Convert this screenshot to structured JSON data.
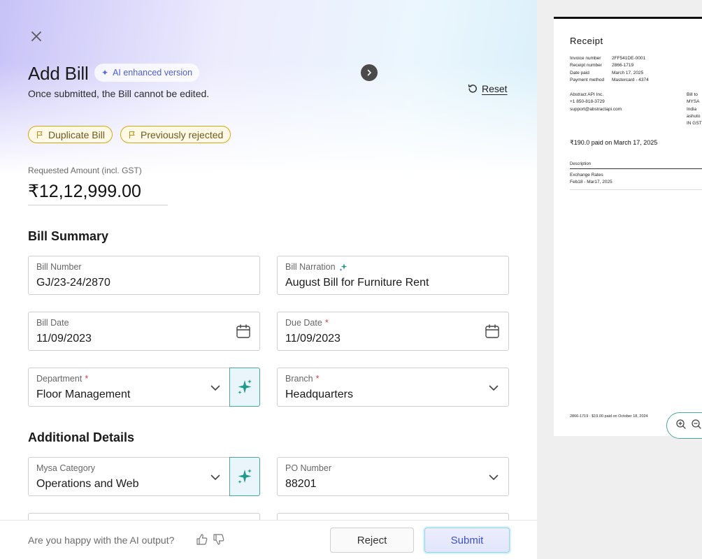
{
  "header": {
    "title": "Add Bill",
    "ai_badge": "AI enhanced version",
    "subtitle": "Once submitted, the Bill cannot be edited.",
    "reset_label": "Reset"
  },
  "tags": [
    {
      "label": "Duplicate Bill"
    },
    {
      "label": "Previously rejected"
    }
  ],
  "requested_amount": {
    "label": "Requested Amount (incl. GST)",
    "value": "₹12,12,999.00"
  },
  "bill_summary": {
    "title": "Bill Summary",
    "bill_number": {
      "label": "Bill Number",
      "value": "GJ/23-24/2870"
    },
    "bill_narration": {
      "label": "Bill Narration",
      "value": "August Bill for Furniture Rent"
    },
    "bill_date": {
      "label": "Bill Date",
      "value": "11/09/2023"
    },
    "due_date": {
      "label": "Due Date",
      "value": "11/09/2023"
    },
    "department": {
      "label": "Department",
      "value": "Floor Management"
    },
    "branch": {
      "label": "Branch",
      "value": "Headquarters"
    }
  },
  "additional_details": {
    "title": "Additional Details",
    "mysa_category": {
      "label": "Mysa Category",
      "value": "Operations and Web"
    },
    "po_number": {
      "label": "PO Number",
      "value": "88201"
    }
  },
  "footer": {
    "feedback_text": "Are you happy with the AI output?",
    "reject_label": "Reject",
    "submit_label": "Submit"
  },
  "receipt": {
    "title": "Receipt",
    "meta_labels": [
      "Invoice number",
      "Receipt number",
      "Date paid",
      "Payment method"
    ],
    "meta_values": [
      "2FF541DE-0001",
      "2866-1719",
      "March 17, 2025",
      "Mastercard - 4374"
    ],
    "from_lines": [
      "Abstract API Inc.",
      "+1 850-818-3729",
      "support@abstractapi.com"
    ],
    "to_lines": [
      "Bill to",
      "MYSA",
      "India",
      "ashuto",
      "IN GST"
    ],
    "paid_line": "₹190.0 paid on March 17, 2025",
    "desc_header": "Description",
    "item_name": "Exchange Rates",
    "item_period": "Feb18 - Mar17, 2025",
    "footer_line": "2866-1719 · $19.00 paid on October 18, 2024"
  },
  "colors": {
    "accent": "#4a5fd1",
    "tag_border": "#d4a816",
    "teal": "#4aa89a",
    "required": "#d23b3b"
  }
}
